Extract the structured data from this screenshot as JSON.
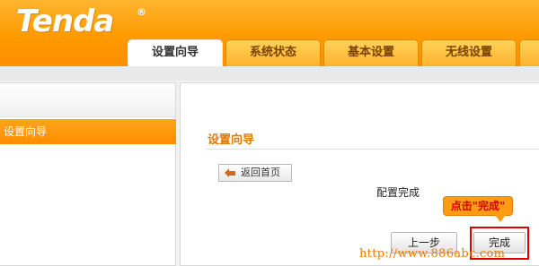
{
  "brand": {
    "logo": "Tenda",
    "reg_mark": "®"
  },
  "tabs": [
    {
      "label": "设置向导",
      "active": true
    },
    {
      "label": "系统状态",
      "active": false
    },
    {
      "label": "基本设置",
      "active": false
    },
    {
      "label": "无线设置",
      "active": false
    }
  ],
  "sidebar": {
    "items": [
      {
        "label": "设置向导",
        "active": true
      }
    ]
  },
  "main": {
    "title": "设置向导",
    "back_button": "返回首页",
    "status_text": "配置完成",
    "callout": "点击\"完成\"",
    "prev_button": "上一步",
    "finish_button": "完成"
  },
  "watermark": "http://www.886abc.com",
  "colors": {
    "brand_orange": "#ff9a00",
    "highlight_red": "#e00000"
  }
}
